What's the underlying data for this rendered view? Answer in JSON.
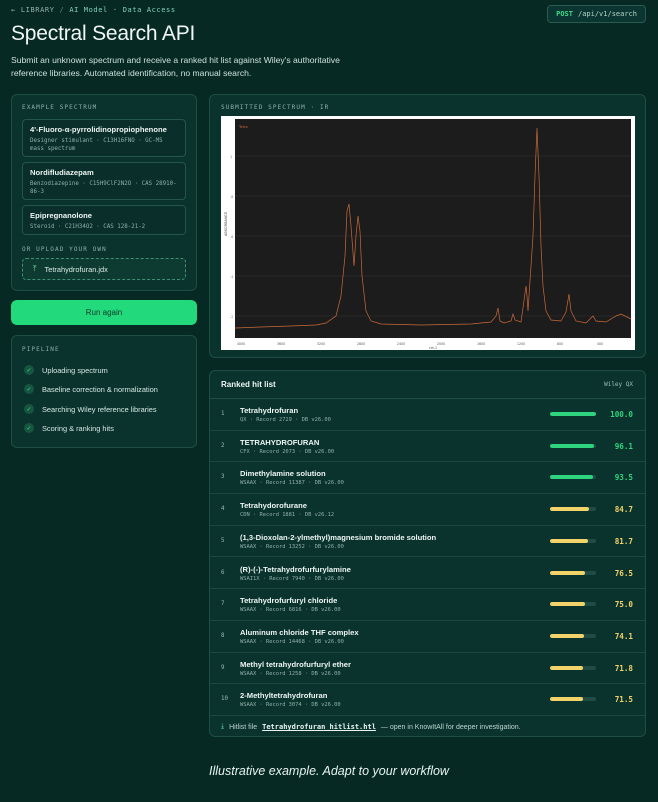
{
  "breadcrumb": {
    "root": "LIBRARY",
    "section": "AI Model",
    "page": "Data Access"
  },
  "endpoint": {
    "method": "POST",
    "path": "/api/v1/search"
  },
  "page": {
    "title": "Spectral Search API",
    "subtitle": "Submit an unknown spectrum and receive a ranked hit list against Wiley's authoritative reference libraries. Automated identification, no manual search."
  },
  "examples": {
    "label": "EXAMPLE SPECTRUM",
    "items": [
      {
        "name": "4'-Fluoro-α-pyrrolidinopropiophenone",
        "meta": "Designer stimulant · C13H16FNO · GC-MS mass spectrum"
      },
      {
        "name": "Nordifludiazepam",
        "meta": "Benzodiazepine · C15H9ClF2N2O · CAS 28910-86-3"
      },
      {
        "name": "Epipregnanolone",
        "meta": "Steroid · C21H34O2 · CAS 128-21-2"
      }
    ],
    "upload_label": "OR UPLOAD YOUR OWN",
    "upload_file": "Tetrahydrofuran.jdx",
    "upload_icon": "upload-arrow-icon"
  },
  "run_button": "Run again",
  "pipeline": {
    "label": "PIPELINE",
    "steps": [
      "Uploading spectrum",
      "Baseline correction & normalization",
      "Searching Wiley reference libraries",
      "Scoring & ranking hits"
    ]
  },
  "spectrum": {
    "label": "SUBMITTED SPECTRUM · IR",
    "legend": "Tetra",
    "y_axis": "ABSORBANCE",
    "x_axis": "cm-1"
  },
  "hits": {
    "title": "Ranked hit list",
    "score_label": "Wiley QX",
    "items": [
      {
        "rank": "1",
        "name": "Tetrahydrofuran",
        "meta": "QX · Record 2729 · DB v26.00",
        "score": "100.0",
        "value": 100.0
      },
      {
        "rank": "2",
        "name": "TETRAHYDROFURAN",
        "meta": "CFX · Record 2073 · DB v26.00",
        "score": "96.1",
        "value": 96.1
      },
      {
        "rank": "3",
        "name": "Dimethylamine solution",
        "meta": "WSAAX · Record 11387 · DB v26.00",
        "score": "93.5",
        "value": 93.5
      },
      {
        "rank": "4",
        "name": "Tetrahydorofurane",
        "meta": "CDN · Record 1881 · DB v26.12",
        "score": "84.7",
        "value": 84.7
      },
      {
        "rank": "5",
        "name": "(1,3-Dioxolan-2-ylmethyl)magnesium bromide solution",
        "meta": "WSAAX · Record 13252 · DB v26.00",
        "score": "81.7",
        "value": 81.7
      },
      {
        "rank": "6",
        "name": "(R)-(-)-Tetrahydrofurfurylamine",
        "meta": "WSAI1X · Record 7940 · DB v26.00",
        "score": "76.5",
        "value": 76.5
      },
      {
        "rank": "7",
        "name": "Tetrahydrofurfuryl chloride",
        "meta": "WSAAX · Record 6816 · DB v26.00",
        "score": "75.0",
        "value": 75.0
      },
      {
        "rank": "8",
        "name": "Aluminum chloride THF complex",
        "meta": "WSAAX · Record 14468 · DB v26.00",
        "score": "74.1",
        "value": 74.1
      },
      {
        "rank": "9",
        "name": "Methyl tetrahydrofurfuryl ether",
        "meta": "WSAAX · Record 1258 · DB v26.00",
        "score": "71.8",
        "value": 71.8
      },
      {
        "rank": "10",
        "name": "2-Methyltetrahydrofuran",
        "meta": "WSAAX · Record 3074 · DB v26.00",
        "score": "71.5",
        "value": 71.5
      }
    ],
    "footer_prefix": "Hitlist file",
    "footer_file": "Tetrahydrofuran_hitlist.htl",
    "footer_suffix": "— open in KnowItAll for deeper investigation."
  },
  "caption": "Illustrative example. Adapt to your workflow",
  "colors": {
    "accent": "#22d97b",
    "high": "#2ed47e",
    "mid": "#f1d36a",
    "trace": "#c96a3a"
  }
}
